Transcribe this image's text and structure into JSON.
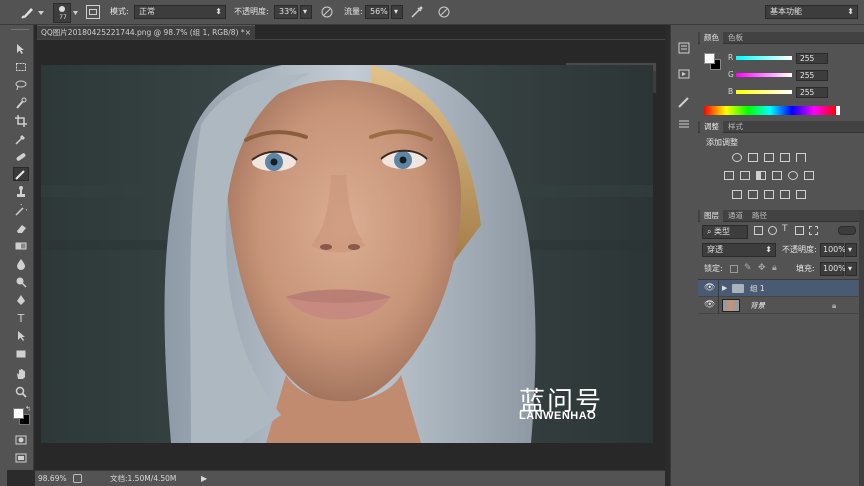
{
  "options_bar": {
    "brush_size": "77",
    "mode_label": "模式:",
    "mode_value": "正常",
    "opacity_label": "不透明度:",
    "opacity_value": "33%",
    "flow_label": "流量:",
    "flow_value": "56%",
    "workspace": "基本功能"
  },
  "document": {
    "tab_title": "QQ图片20180425221744.png @ 98.7% (组 1, RGB/8) *",
    "close": "×",
    "watermark_cn": "蓝问号",
    "watermark_en": "LANWENHAO",
    "zoom": "98.69%",
    "doc_info": "文档:1.50M/4.50M"
  },
  "color_panel": {
    "tabs": [
      "颜色",
      "色板"
    ],
    "channels": [
      {
        "label": "R",
        "value": "255"
      },
      {
        "label": "G",
        "value": "255"
      },
      {
        "label": "B",
        "value": "255"
      }
    ],
    "foreground": "#ffffff",
    "background": "#000000"
  },
  "adjust_panel": {
    "tabs": [
      "调整",
      "样式"
    ],
    "title": "添加调整"
  },
  "layers_panel": {
    "tabs": [
      "图层",
      "通道",
      "路径"
    ],
    "filter_kind": "类型",
    "blend_mode": "穿透",
    "opacity_label": "不透明度:",
    "opacity_value": "100%",
    "lock_label": "锁定:",
    "fill_label": "填充:",
    "fill_value": "100%",
    "layers": [
      {
        "name": "组 1"
      },
      {
        "name": "背景"
      }
    ]
  },
  "colors": {
    "panel": "#535353",
    "selection": "#4a5a72"
  }
}
